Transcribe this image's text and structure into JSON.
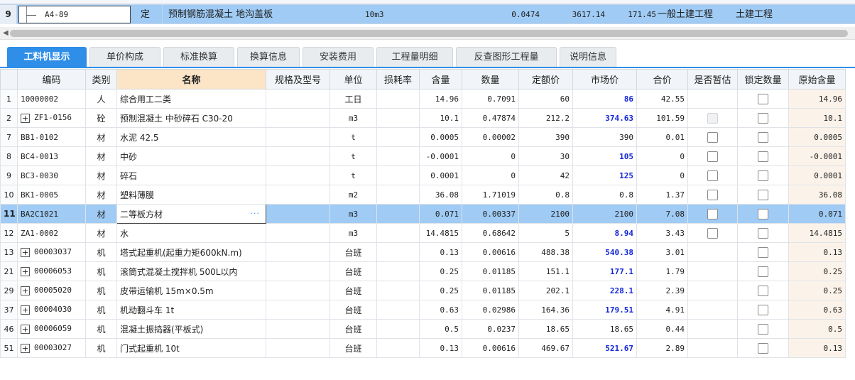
{
  "top_row": {
    "index": "9",
    "code": "A4-89",
    "type": "定",
    "name": "预制钢筋混凝土 地沟盖板",
    "unit": "10m3",
    "qty": "0.0474",
    "price": "3617.14",
    "total": "171.45",
    "category": "一般土建工程",
    "discipline": "土建工程"
  },
  "tabs": [
    {
      "label": "工料机显示",
      "active": true
    },
    {
      "label": "单价构成"
    },
    {
      "label": "标准换算"
    },
    {
      "label": "换算信息"
    },
    {
      "label": "安装费用"
    },
    {
      "label": "工程量明细"
    },
    {
      "label": "反查图形工程量"
    },
    {
      "label": "说明信息"
    }
  ],
  "columns": [
    "编码",
    "类别",
    "名称",
    "规格及型号",
    "单位",
    "损耗率",
    "含量",
    "数量",
    "定额价",
    "市场价",
    "合价",
    "是否暂估",
    "锁定数量",
    "原始含量"
  ],
  "rows": [
    {
      "rn": "1",
      "code": "10000002",
      "cat": "人",
      "name": "综合用工二类",
      "unit": "工日",
      "content": "14.96",
      "qty": "0.7091",
      "quota": "60",
      "market": "86",
      "changed": true,
      "total": "42.55",
      "est": "none",
      "orig": "14.96"
    },
    {
      "rn": "2",
      "code": "ZF1-0156",
      "expand": true,
      "cat": "砼",
      "name": "预制混凝土 中砂碎石 C30-20",
      "unit": "m3",
      "unit_small": true,
      "content": "10.1",
      "qty": "0.47874",
      "quota": "212.2",
      "market": "374.63",
      "changed": true,
      "total": "101.59",
      "est": "disabled",
      "orig": "10.1"
    },
    {
      "rn": "7",
      "code": "BB1-0102",
      "cat": "材",
      "name": "水泥 42.5",
      "unit": "t",
      "unit_small": true,
      "content": "0.0005",
      "qty": "0.00002",
      "quota": "390",
      "market": "390",
      "total": "0.01",
      "est": "box",
      "orig": "0.0005"
    },
    {
      "rn": "8",
      "code": "BC4-0013",
      "cat": "材",
      "name": "中砂",
      "unit": "t",
      "unit_small": true,
      "content": "-0.0001",
      "qty": "0",
      "quota": "30",
      "market": "105",
      "changed": true,
      "total": "0",
      "est": "box",
      "orig": "-0.0001"
    },
    {
      "rn": "9",
      "code": "BC3-0030",
      "cat": "材",
      "name": "碎石",
      "unit": "t",
      "unit_small": true,
      "content": "0.0001",
      "qty": "0",
      "quota": "42",
      "market": "125",
      "changed": true,
      "total": "0",
      "est": "box",
      "orig": "0.0001"
    },
    {
      "rn": "10",
      "code": "BK1-0005",
      "cat": "材",
      "name": "塑料薄膜",
      "unit": "m2",
      "unit_small": true,
      "content": "36.08",
      "qty": "1.71019",
      "quota": "0.8",
      "market": "0.8",
      "total": "1.37",
      "est": "box",
      "orig": "36.08"
    },
    {
      "rn": "11",
      "code": "BA2C1021",
      "cat": "材",
      "name": "二等板方材",
      "unit": "m3",
      "unit_small": true,
      "content": "0.071",
      "qty": "0.00337",
      "quota": "2100",
      "market": "2100",
      "total": "7.08",
      "est": "box",
      "orig": "0.071",
      "selected": true
    },
    {
      "rn": "12",
      "code": "ZA1-0002",
      "cat": "材",
      "name": "水",
      "unit": "m3",
      "unit_small": true,
      "content": "14.4815",
      "qty": "0.68642",
      "quota": "5",
      "market": "8.94",
      "changed": true,
      "total": "3.43",
      "est": "box",
      "orig": "14.4815"
    },
    {
      "rn": "13",
      "code": "00003037",
      "expand": true,
      "cat": "机",
      "name": "塔式起重机(起重力矩600kN.m)",
      "unit": "台班",
      "content": "0.13",
      "qty": "0.00616",
      "quota": "488.38",
      "market": "540.38",
      "changed": true,
      "total": "3.01",
      "est": "none",
      "orig": "0.13"
    },
    {
      "rn": "21",
      "code": "00006053",
      "expand": true,
      "cat": "机",
      "name": "滚筒式混凝土搅拌机 500L以内",
      "unit": "台班",
      "content": "0.25",
      "qty": "0.01185",
      "quota": "151.1",
      "market": "177.1",
      "changed": true,
      "total": "1.79",
      "est": "none",
      "orig": "0.25"
    },
    {
      "rn": "29",
      "code": "00005020",
      "expand": true,
      "cat": "机",
      "name": "皮带运输机 15m×0.5m",
      "unit": "台班",
      "content": "0.25",
      "qty": "0.01185",
      "quota": "202.1",
      "market": "228.1",
      "changed": true,
      "total": "2.39",
      "est": "none",
      "orig": "0.25"
    },
    {
      "rn": "37",
      "code": "00004030",
      "expand": true,
      "cat": "机",
      "name": "机动翻斗车 1t",
      "unit": "台班",
      "content": "0.63",
      "qty": "0.02986",
      "quota": "164.36",
      "market": "179.51",
      "changed": true,
      "total": "4.91",
      "est": "none",
      "orig": "0.63"
    },
    {
      "rn": "46",
      "code": "00006059",
      "expand": true,
      "cat": "机",
      "name": "混凝土振捣器(平板式)",
      "unit": "台班",
      "content": "0.5",
      "qty": "0.0237",
      "quota": "18.65",
      "market": "18.65",
      "total": "0.44",
      "est": "none",
      "orig": "0.5"
    },
    {
      "rn": "51",
      "code": "00003027",
      "expand": true,
      "cat": "机",
      "name": "门式起重机 10t",
      "unit": "台班",
      "content": "0.13",
      "qty": "0.00616",
      "quota": "469.67",
      "market": "521.67",
      "changed": true,
      "total": "2.89",
      "est": "none",
      "orig": "0.13"
    }
  ],
  "colors": {
    "accent": "#2f8ee8",
    "selected_row": "#9fcbf5",
    "changed_price": "#1428d8",
    "name_header": "#fce4c6"
  }
}
